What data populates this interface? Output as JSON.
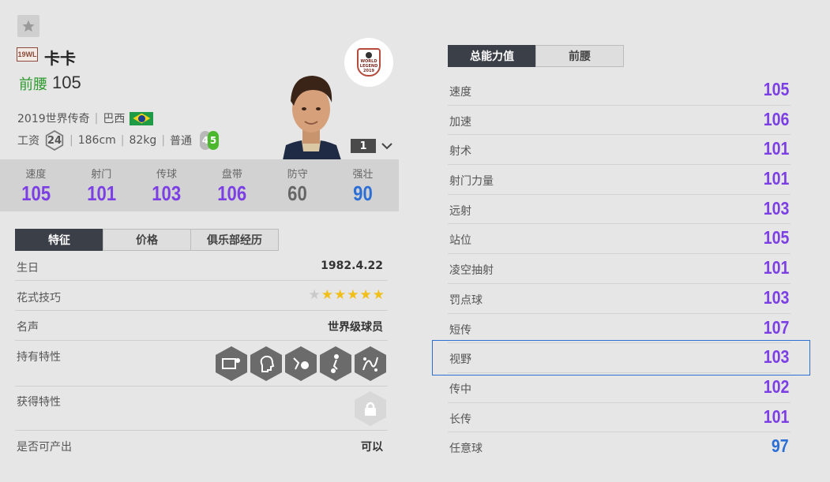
{
  "player": {
    "season_badge": "19WL",
    "name": "卡卡",
    "position": "前腰",
    "overall": "105",
    "season_text": "2019世界传奇",
    "nation": "巴西",
    "salary_label": "工资",
    "salary": "24",
    "height": "186cm",
    "weight": "82kg",
    "body_type": "普通",
    "weak_foot_left": "4",
    "weak_foot_right": "5",
    "level": "1",
    "club_logo_text": [
      "WORLD",
      "LEGEND",
      "2019"
    ]
  },
  "summary_stats": [
    {
      "label": "速度",
      "value": "105",
      "color": "#7b3fe4"
    },
    {
      "label": "射门",
      "value": "101",
      "color": "#7b3fe4"
    },
    {
      "label": "传球",
      "value": "103",
      "color": "#7b3fe4"
    },
    {
      "label": "盘带",
      "value": "106",
      "color": "#7b3fe4"
    },
    {
      "label": "防守",
      "value": "60",
      "color": "#666666"
    },
    {
      "label": "强壮",
      "value": "90",
      "color": "#2b6fd6"
    }
  ],
  "left_tabs": [
    "特征",
    "价格",
    "俱乐部经历"
  ],
  "info": {
    "birthday_label": "生日",
    "birthday": "1982.4.22",
    "skill_moves_label": "花式技巧",
    "skill_moves_rating": 5,
    "reputation_label": "名声",
    "reputation": "世界级球员",
    "traits_label": "持有特性",
    "traits": [
      "finesse-shot-icon",
      "playmaker-icon",
      "flair-icon",
      "dribbler-icon",
      "speed-dribbler-icon"
    ],
    "acquired_traits_label": "获得特性",
    "tradable_label": "是否可产出",
    "tradable": "可以"
  },
  "right_tabs": [
    "总能力值",
    "前腰"
  ],
  "attributes": [
    {
      "name": "速度",
      "value": "105",
      "color": "#7b3fe4"
    },
    {
      "name": "加速",
      "value": "106",
      "color": "#7b3fe4"
    },
    {
      "name": "射术",
      "value": "101",
      "color": "#7b3fe4"
    },
    {
      "name": "射门力量",
      "value": "101",
      "color": "#7b3fe4"
    },
    {
      "name": "远射",
      "value": "103",
      "color": "#7b3fe4"
    },
    {
      "name": "站位",
      "value": "105",
      "color": "#7b3fe4"
    },
    {
      "name": "凌空抽射",
      "value": "101",
      "color": "#7b3fe4"
    },
    {
      "name": "罚点球",
      "value": "103",
      "color": "#7b3fe4"
    },
    {
      "name": "短传",
      "value": "107",
      "color": "#7b3fe4"
    },
    {
      "name": "视野",
      "value": "103",
      "color": "#7b3fe4"
    },
    {
      "name": "传中",
      "value": "102",
      "color": "#7b3fe4"
    },
    {
      "name": "长传",
      "value": "101",
      "color": "#7b3fe4"
    },
    {
      "name": "任意球",
      "value": "97",
      "color": "#2b6fd6"
    }
  ],
  "highlighted_attribute": "视野"
}
